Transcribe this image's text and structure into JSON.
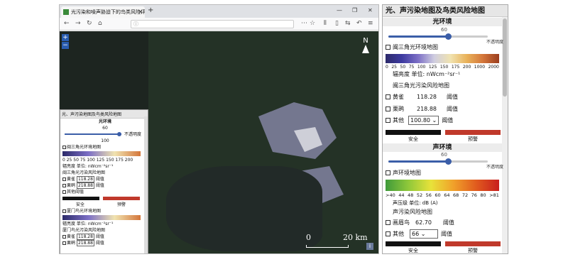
{
  "browser": {
    "tab_title": "光污染和噪声胁迫下的鸟类风险评价平台",
    "close": "×",
    "newtab": "+",
    "min": "—",
    "max": "❐",
    "close_win": "✕"
  },
  "map": {
    "zoom_in": "+",
    "zoom_out": "−",
    "north": "N",
    "scale_0": "0",
    "scale_1": "20 km",
    "info": "i"
  },
  "small_panel": {
    "title": "光、声污染地图及鸟类风险地图",
    "light_env": "光环境",
    "slider_value": "60",
    "opaque": "不透明度",
    "max": "100",
    "map_chk": "闽三角光环境地图",
    "ticks": [
      "0",
      "25",
      "50",
      "75",
      "100",
      "125",
      "150",
      "175",
      "200"
    ],
    "unit": "辐亮度 单位: nWcm⁻²sr⁻¹",
    "risk_title": "闽三角光污染风险地图",
    "birds": [
      {
        "name": "黄雀",
        "val": "118.28",
        "lbl": "阈值"
      },
      {
        "name": "栗鹀",
        "val": "218.88",
        "lbl": "阈值"
      },
      {
        "name": "其他",
        "val": "",
        "lbl": "阈值"
      }
    ],
    "safe": "安全",
    "warn": "预警",
    "xm_chk": "厦门鸟光环境地图",
    "unit2": "辐亮度 单位: nWcm⁻²sr⁻¹",
    "xm_risk": "厦门鸟光污染风险地图",
    "xm_birds": [
      {
        "name": "黄雀",
        "val": "118.28",
        "lbl": "阈值"
      },
      {
        "name": "栗鹀",
        "val": "218.88",
        "lbl": "阈值"
      }
    ]
  },
  "panel": {
    "title": "光、声污染地图及鸟类风险地图",
    "light": {
      "heading": "光环境",
      "slider_value": 60,
      "opacity_label": "不透明度",
      "map_label": "闽三角光环境地图",
      "ticks": [
        "0",
        "25",
        "50",
        "75",
        "100",
        "125",
        "150",
        "175",
        "200",
        "1000",
        "2000"
      ],
      "unit": "辐亮度 单位: nWcm⁻²sr⁻¹",
      "risk_title": "闽三角光污染风险地图",
      "birds": [
        {
          "name": "黄雀",
          "value": "118.28",
          "label": "阈值"
        },
        {
          "name": "栗鹀",
          "value": "218.88",
          "label": "阈值"
        }
      ],
      "other_name": "其他",
      "other_value": "100.80",
      "other_label": "阈值",
      "safe": "安全",
      "warn": "预警"
    },
    "sound": {
      "heading": "声环境",
      "slider_value": 60,
      "opacity_label": "不透明度",
      "map_label": "声环境地图",
      "ticks": [
        ">40",
        "44",
        "48",
        "52",
        "56",
        "60",
        "64",
        "68",
        "72",
        "76",
        "80",
        ">81"
      ],
      "unit": "声压级 单位: dB (A)",
      "risk_title": "声污染风险地图",
      "birds": [
        {
          "name": "画眉鸟",
          "value": "62.70",
          "label": "阈值"
        }
      ],
      "other_name": "其他",
      "other_value": "66",
      "other_label": "阈值",
      "safe": "安全",
      "warn": "预警"
    }
  },
  "colors": {
    "accent": "#3b5ea8",
    "warn": "#c0392b",
    "safe": "#111111"
  }
}
